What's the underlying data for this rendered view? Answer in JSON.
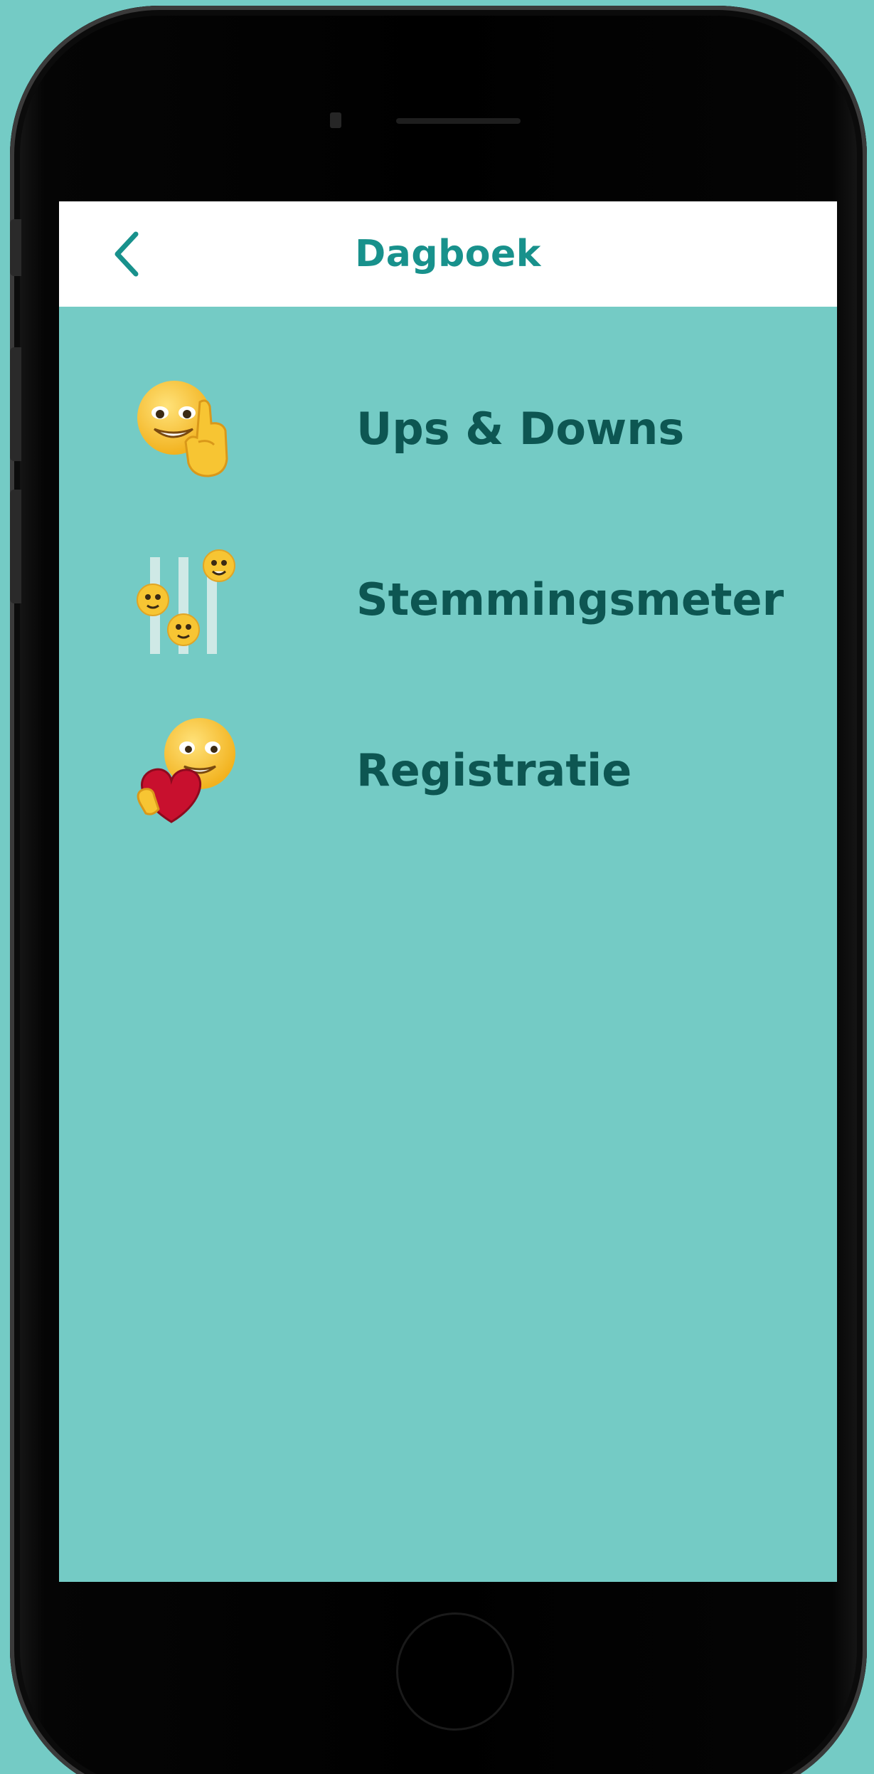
{
  "screen": {
    "title": "Dagboek",
    "back_icon": "chevron-left-icon"
  },
  "menu": {
    "items": [
      {
        "label": "Ups & Downs",
        "icon": "face-thumbs-up-icon"
      },
      {
        "label": "Stemmingsmeter",
        "icon": "mood-sliders-icon"
      },
      {
        "label": "Registratie",
        "icon": "face-heart-icon"
      }
    ]
  },
  "colors": {
    "background": "#74cbc5",
    "header_bg": "#ffffff",
    "title": "#18918c",
    "menu_text": "#0d5652",
    "emoji_yellow": "#f7c533",
    "heart_red": "#c8102e"
  }
}
